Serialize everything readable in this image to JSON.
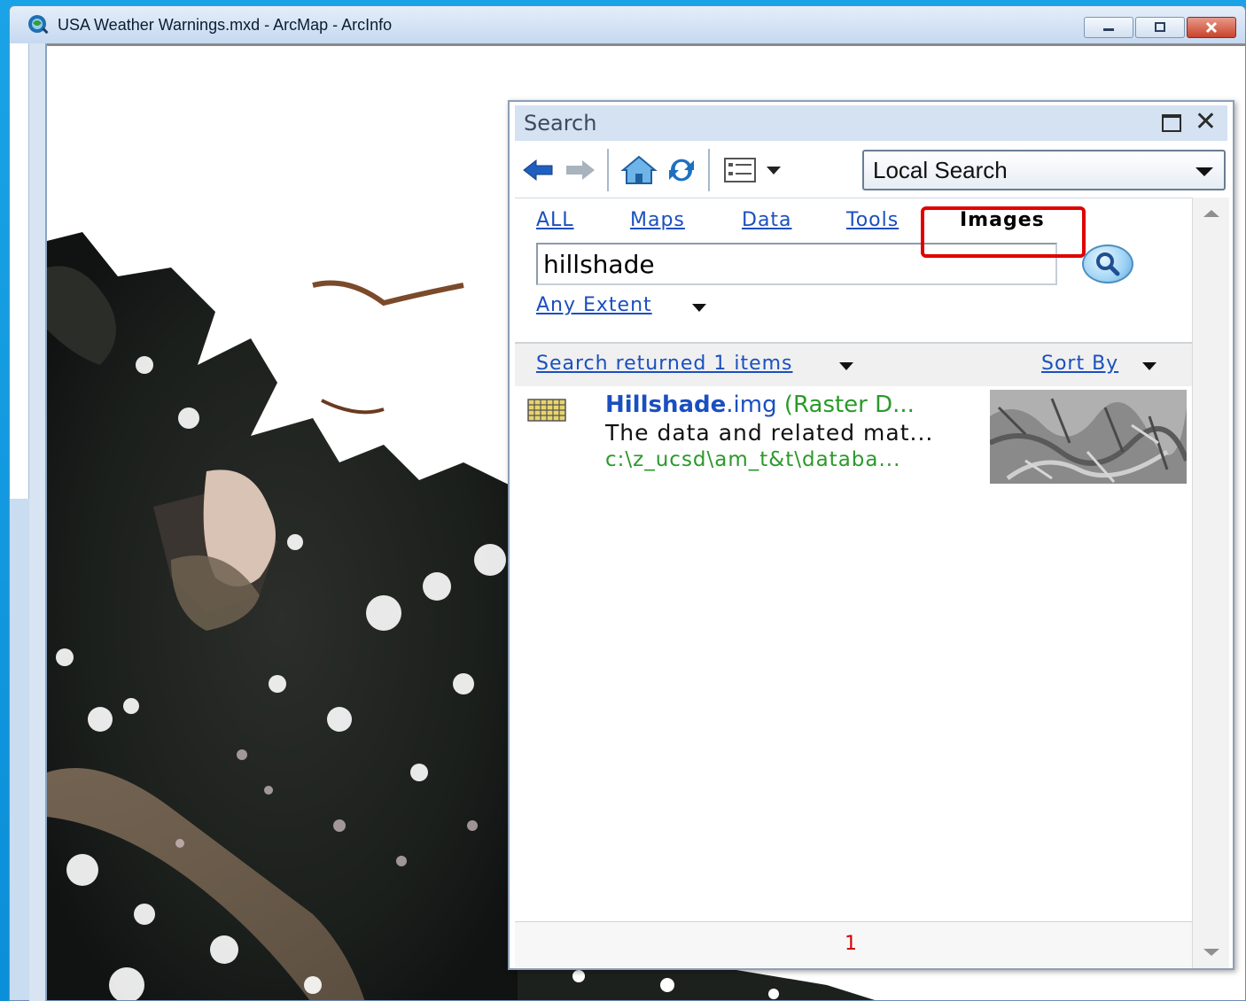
{
  "window": {
    "title": "USA Weather Warnings.mxd - ArcMap - ArcInfo",
    "controls": [
      "minimize",
      "restore",
      "close"
    ]
  },
  "search_panel": {
    "title": "Search",
    "toolbar": {
      "icons": [
        "back-arrow-icon",
        "forward-arrow-icon",
        "home-icon",
        "refresh-icon",
        "view-options-icon"
      ],
      "scope_value": "Local Search"
    },
    "tabs": [
      {
        "label": "ALL"
      },
      {
        "label": "Maps"
      },
      {
        "label": "Data"
      },
      {
        "label": "Tools"
      },
      {
        "label": "Images",
        "selected": true
      }
    ],
    "search_value": "hillshade",
    "extent_label": "Any Extent",
    "results_label": "Search returned 1 items",
    "sort_label": "Sort By",
    "results": [
      {
        "name": "Hillshade",
        "extension": ".img",
        "type": " (Raster D...",
        "description": "The data and related mat...",
        "path": "c:\\z_ucsd\\am_t&t\\databa..."
      }
    ],
    "page": "1"
  },
  "colors": {
    "link": "#1a4fbf",
    "path_green": "#2a9a2a",
    "highlight_red": "#e00000",
    "desktop_blue": "#0a8fd8"
  }
}
